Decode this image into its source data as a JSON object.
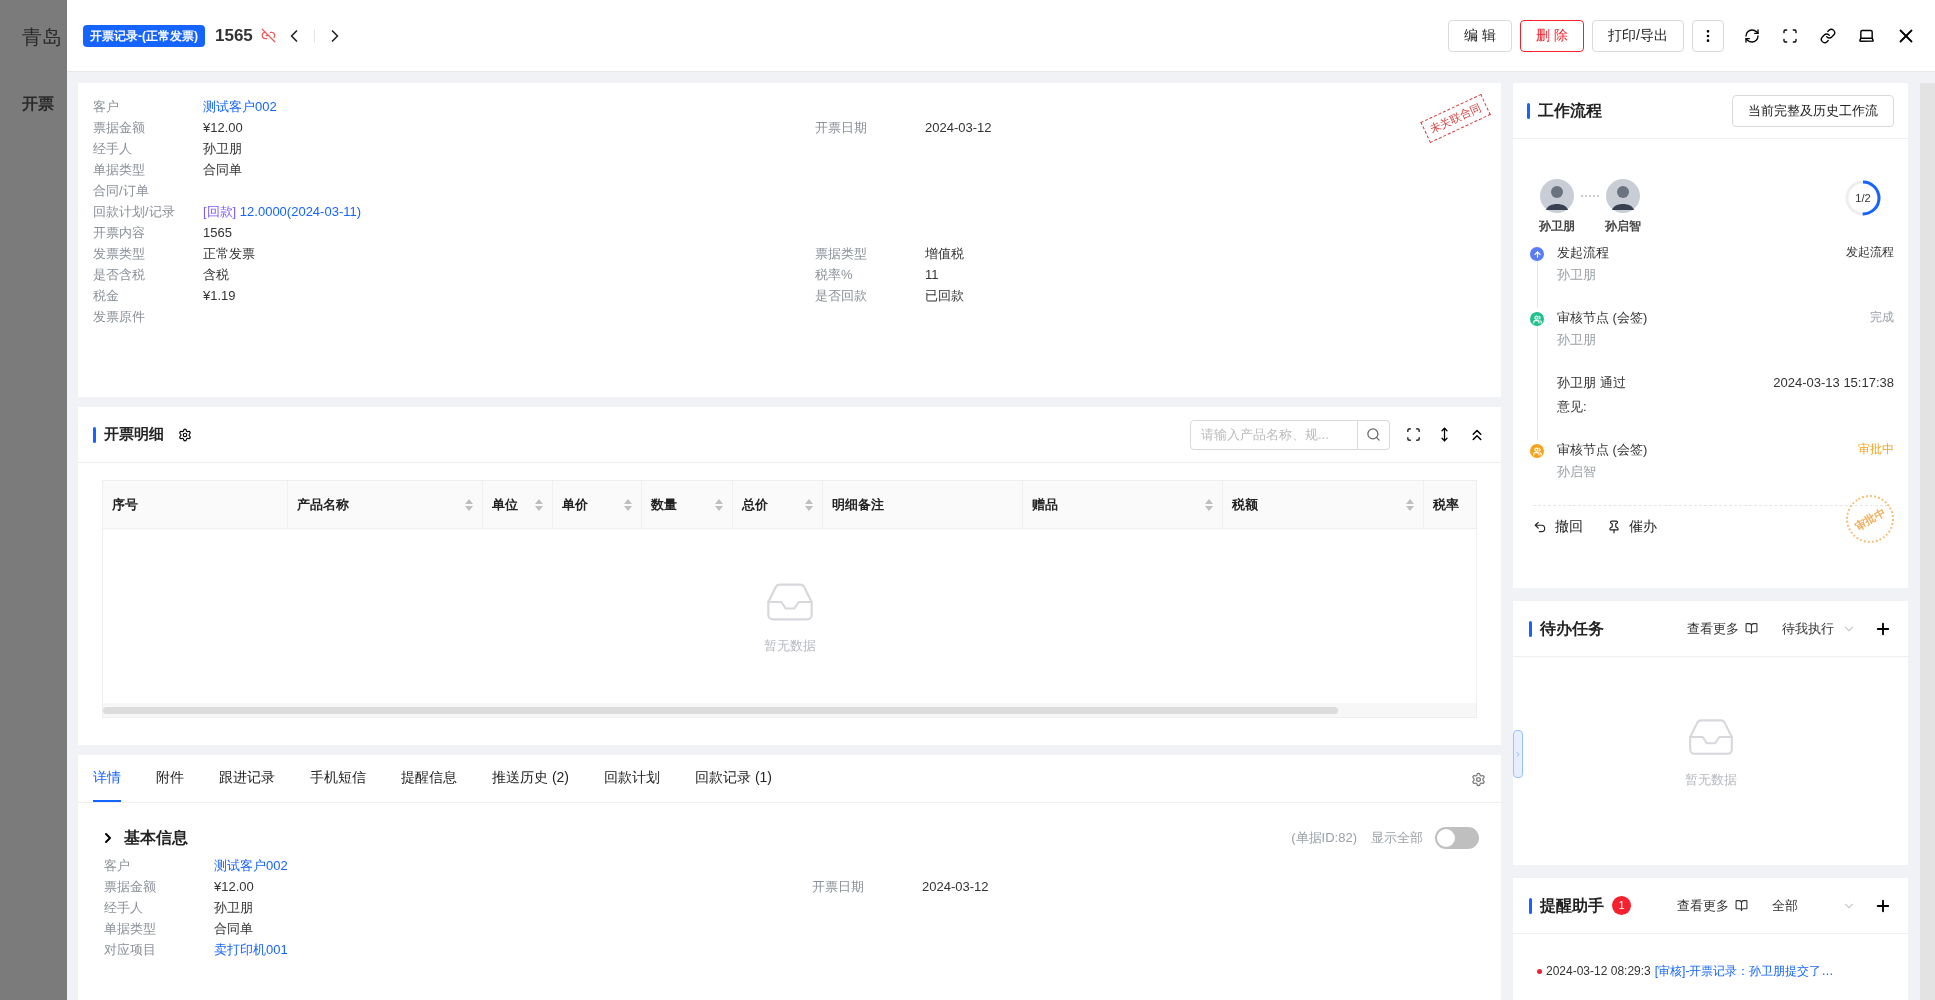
{
  "background_page": {
    "title": "青岛",
    "section": "开票"
  },
  "header": {
    "badge": "开票记录-(正常发票)",
    "record_no": "1565",
    "actions": [
      {
        "label": "编 辑",
        "kind": "default"
      },
      {
        "label": "删 除",
        "kind": "danger"
      },
      {
        "label": "打印/导出",
        "kind": "default"
      }
    ]
  },
  "info": {
    "stamp": "未关联合同",
    "rows": [
      {
        "left": {
          "label": "客户",
          "value": "测试客户002",
          "kind": "link"
        }
      },
      {
        "left": {
          "label": "票据金额",
          "value": "¥12.00",
          "kind": "text"
        },
        "right": {
          "label": "开票日期",
          "value": "2024-03-12",
          "kind": "text"
        }
      },
      {
        "left": {
          "label": "经手人",
          "value": "孙卫朋",
          "kind": "text"
        }
      },
      {
        "left": {
          "label": "单据类型",
          "value": "合同单",
          "kind": "text"
        }
      },
      {
        "left": {
          "label": "合同/订单"
        }
      },
      {
        "left": {
          "label": "回款计划/记录",
          "tag": "[回款]",
          "value": "12.0000(2024-03-11)",
          "kind": "link"
        }
      },
      {
        "left": {
          "label": "开票内容",
          "value": "1565",
          "kind": "text"
        }
      },
      {
        "left": {
          "label": "发票类型",
          "value": "正常发票",
          "kind": "text"
        },
        "right": {
          "label": "票据类型",
          "value": "增值税",
          "kind": "text"
        }
      },
      {
        "left": {
          "label": "是否含税",
          "value": "含税",
          "kind": "text"
        },
        "right": {
          "label": "税率%",
          "value": "11",
          "kind": "text"
        }
      },
      {
        "left": {
          "label": "税金",
          "value": "¥1.19",
          "kind": "text"
        },
        "right": {
          "label": "是否回款",
          "value": "已回款",
          "kind": "text"
        }
      },
      {
        "left": {
          "label": "发票原件"
        }
      }
    ]
  },
  "detail_table": {
    "title": "开票明细",
    "search_placeholder": "请输入产品名称、规...",
    "empty_text": "暂无数据",
    "columns": [
      {
        "label": "序号",
        "sortable": false
      },
      {
        "label": "产品名称",
        "sortable": true
      },
      {
        "label": "单位",
        "sortable": true
      },
      {
        "label": "单价",
        "sortable": true
      },
      {
        "label": "数量",
        "sortable": true
      },
      {
        "label": "总价",
        "sortable": true
      },
      {
        "label": "明细备注",
        "sortable": false
      },
      {
        "label": "赠品",
        "sortable": true
      },
      {
        "label": "税额",
        "sortable": true
      },
      {
        "label": "税率"
      }
    ]
  },
  "tabs": [
    {
      "label": "详情",
      "selected": true
    },
    {
      "label": "附件",
      "selected": false
    },
    {
      "label": "跟进记录",
      "selected": false
    },
    {
      "label": "手机短信",
      "selected": false
    },
    {
      "label": "提醒信息",
      "selected": false
    },
    {
      "label": "推送历史 (2)",
      "selected": false
    },
    {
      "label": "回款计划",
      "selected": false
    },
    {
      "label": "回款记录 (1)",
      "selected": false
    }
  ],
  "basic_info": {
    "title": "基本信息",
    "doc_id": "(单据ID:82)",
    "show_all": {
      "label": "显示全部",
      "on": false
    },
    "rows": [
      {
        "left": {
          "label": "客户",
          "value": "测试客户002",
          "kind": "link"
        }
      },
      {
        "left": {
          "label": "票据金额",
          "value": "¥12.00",
          "kind": "text"
        },
        "right": {
          "label": "开票日期",
          "value": "2024-03-12",
          "kind": "text"
        }
      },
      {
        "left": {
          "label": "经手人",
          "value": "孙卫朋",
          "kind": "text"
        }
      },
      {
        "left": {
          "label": "单据类型",
          "value": "合同单",
          "kind": "text"
        }
      },
      {
        "left": {
          "label": "对应项目",
          "value": "卖打印机001",
          "kind": "link"
        }
      }
    ]
  },
  "workflow": {
    "title": "工作流程",
    "history_button": "当前完整及历史工作流",
    "participants": [
      "孙卫朋",
      "孙启智"
    ],
    "progress": {
      "label": "1/2",
      "level": 0.5
    },
    "steps": [
      {
        "kind": "start",
        "title": "发起流程",
        "person": "孙卫朋",
        "status": "发起流程"
      },
      {
        "kind": "done",
        "title": "审核节点 (会签)",
        "person": "孙卫朋",
        "status": "完成",
        "comment": {
          "result": "孙卫朋 通过",
          "time": "2024-03-13 15:17:38",
          "opinion": "意见:"
        }
      },
      {
        "kind": "pending",
        "title": "审核节点 (会签)",
        "person": "孙启智",
        "status": "审批中"
      }
    ],
    "actions": [
      "撤回",
      "催办"
    ],
    "stamp": "审批中"
  },
  "todo": {
    "title": "待办任务",
    "more": "查看更多",
    "filter": "待我执行",
    "empty_text": "暂无数据"
  },
  "reminders": {
    "title": "提醒助手",
    "count": "1",
    "more": "查看更多",
    "filter": "全部",
    "items": [
      {
        "time": "2024-03-12 08:29:3",
        "text": "[审核]-开票记录：孙卫朋提交了…"
      }
    ]
  }
}
